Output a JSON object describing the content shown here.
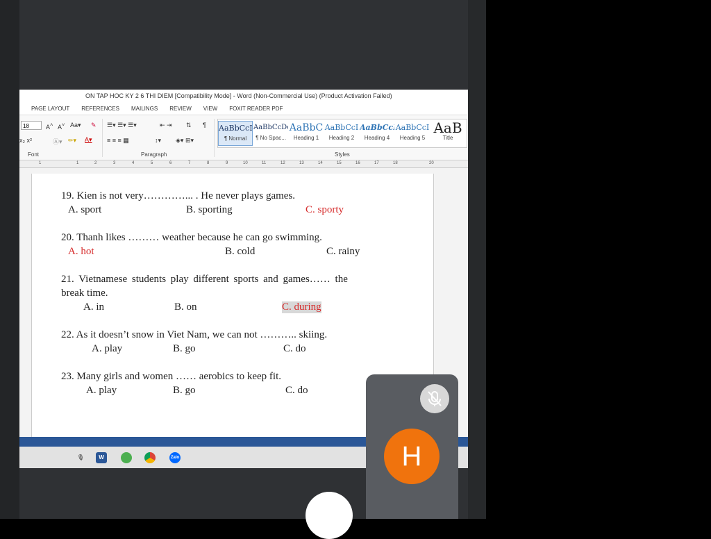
{
  "window": {
    "title": "ON TAP HOC KY 2 6 THI DIEM [Compatibility Mode] - Word (Non-Commercial Use) (Product Activation Failed)"
  },
  "menu": [
    "PAGE LAYOUT",
    "REFERENCES",
    "MAILINGS",
    "REVIEW",
    "VIEW",
    "FOXIT READER PDF"
  ],
  "ribbon": {
    "font_size": "18",
    "group_font": "Font",
    "group_paragraph": "Paragraph",
    "group_styles": "Styles",
    "styles": [
      {
        "sample": "AaBbCcI",
        "name": "¶ Normal"
      },
      {
        "sample": "AaBbCcDc",
        "name": "¶ No Spac..."
      },
      {
        "sample": "AaBbC",
        "name": "Heading 1"
      },
      {
        "sample": "AaBbCcI",
        "name": "Heading 2"
      },
      {
        "sample": "AaBbCcI",
        "name": "Heading 4"
      },
      {
        "sample": "AaBbCcI",
        "name": "Heading 5"
      },
      {
        "sample": "AaB",
        "name": "Title"
      }
    ]
  },
  "ruler": [
    "1",
    "1",
    "2",
    "3",
    "4",
    "5",
    "6",
    "7",
    "8",
    "9",
    "10",
    "11",
    "12",
    "13",
    "14",
    "15",
    "16",
    "17",
    "18",
    "20"
  ],
  "questions": [
    {
      "text": "19. Kien is not very…………... . He never plays games.",
      "a": "A. sport",
      "b": "B. sporting",
      "c": "C. sporty"
    },
    {
      "text": "20. Thanh likes ……… weather because he can go swimming.",
      "a": "A. hot",
      "b": "B. cold",
      "c": "C. rainy"
    },
    {
      "text": "21. Vietnamese students play different sports and games…… the",
      "text2": "break time.",
      "a": "A. in",
      "b": "B. on",
      "c": "C. during"
    },
    {
      "text": "22. As it doesn’t snow in Viet Nam, we can not ……….. skiing.",
      "a": "A. play",
      "b": "B. go",
      "c": "C. do"
    },
    {
      "text": "23. Many girls and women …… aerobics to keep fit.",
      "a": "A. play",
      "b": "B. go",
      "c": "C. do"
    }
  ],
  "taskbar": {
    "zalo": "Zalo",
    "word": "W"
  },
  "call": {
    "avatar_letter": "H"
  },
  "colors": {
    "answer_red": "#d62b2b",
    "avatar": "#f0730d",
    "statusbar": "#2b5797"
  }
}
